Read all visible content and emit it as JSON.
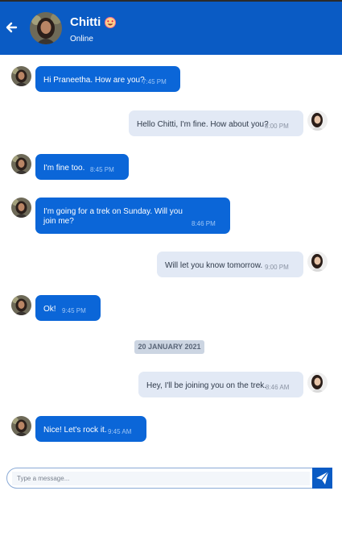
{
  "header": {
    "contact_name": "Chitti",
    "status": "Online",
    "back_icon": "arrow-left-icon",
    "emoji_icon": "heart-eyes-emoji-icon",
    "background_color": "#0a5bc4"
  },
  "messages": [
    {
      "direction": "in",
      "text_lines": [
        "Hi Praneetha. How are you?"
      ],
      "time": "7:45 PM"
    },
    {
      "direction": "out",
      "text_lines": [
        "Hello Chitti, I'm fine. How about you?"
      ],
      "time": "8:00 PM"
    },
    {
      "direction": "in",
      "text_lines": [
        "I'm fine too."
      ],
      "time": "8:45 PM"
    },
    {
      "direction": "in",
      "text_lines": [
        "I'm going for a trek on Sunday. Will you",
        "join me?"
      ],
      "time": "8:46 PM"
    },
    {
      "direction": "out",
      "text_lines": [
        "Will let you know tomorrow."
      ],
      "time": "9:00 PM"
    },
    {
      "direction": "in",
      "text_lines": [
        "Ok!"
      ],
      "time": "9:45 PM"
    },
    {
      "direction": "out",
      "text_lines": [
        "Hey, I'll be joining you on the trek."
      ],
      "time": "8:46 AM"
    },
    {
      "direction": "in",
      "text_lines": [
        "Nice! Let's rock it."
      ],
      "time": "9:45 AM"
    }
  ],
  "date_separator": "20 JANUARY 2021",
  "composer": {
    "placeholder": "Type a message...",
    "send_icon": "paper-plane-icon"
  },
  "colors": {
    "incoming_bubble": "#0b66d8",
    "outgoing_bubble": "#e2e9f5"
  }
}
